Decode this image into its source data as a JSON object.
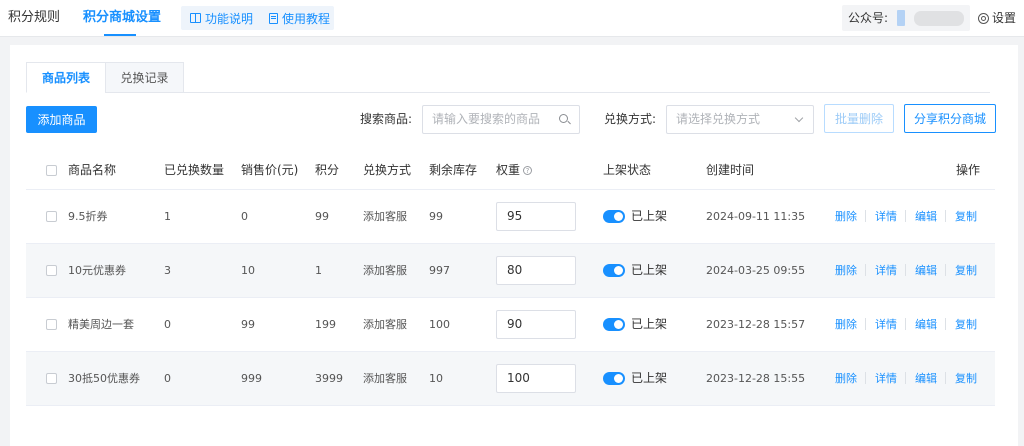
{
  "header": {
    "nav_rules": "积分规则",
    "nav_mall": "积分商城设置",
    "doc_func": "功能说明",
    "doc_tutorial": "使用教程",
    "account_label": "公众号:",
    "settings_label": "设置"
  },
  "tabs": {
    "products": "商品列表",
    "records": "兑换记录"
  },
  "toolbar": {
    "add_label": "添加商品",
    "search_label": "搜索商品:",
    "search_placeholder": "请输入要搜索的商品",
    "exchange_label": "兑换方式:",
    "exchange_placeholder": "请选择兑换方式",
    "bulk_delete_label": "批量删除",
    "share_label": "分享积分商城"
  },
  "table": {
    "headers": {
      "name": "商品名称",
      "exchanged": "已兑换数量",
      "price": "销售价(元)",
      "points": "积分",
      "method": "兑换方式",
      "stock": "剩余库存",
      "weight": "权重",
      "status": "上架状态",
      "created": "创建时间",
      "ops": "操作"
    },
    "rows": [
      {
        "name": "9.5折券",
        "exchanged": "1",
        "price": "0",
        "points": "99",
        "method": "添加客服",
        "stock": "99",
        "weight": "95",
        "status": "已上架",
        "status_on": true,
        "created": "2024-09-11 11:35"
      },
      {
        "name": "10元优惠券",
        "exchanged": "3",
        "price": "10",
        "points": "1",
        "method": "添加客服",
        "stock": "997",
        "weight": "80",
        "status": "已上架",
        "status_on": true,
        "created": "2024-03-25 09:55"
      },
      {
        "name": "精美周边一套",
        "exchanged": "0",
        "price": "99",
        "points": "199",
        "method": "添加客服",
        "stock": "100",
        "weight": "90",
        "status": "已上架",
        "status_on": true,
        "created": "2023-12-28 15:57"
      },
      {
        "name": "30抵50优惠券",
        "exchanged": "0",
        "price": "999",
        "points": "3999",
        "method": "添加客服",
        "stock": "10",
        "weight": "100",
        "status": "已上架",
        "status_on": true,
        "created": "2023-12-28 15:55"
      }
    ],
    "actions": {
      "delete": "删除",
      "detail": "详情",
      "edit": "编辑",
      "copy": "复制"
    }
  },
  "colors": {
    "accent": "#1890ff",
    "row_alt": "#f5f7f9"
  },
  "icons": [
    "book-icon",
    "doc-icon",
    "gear-icon",
    "search-icon",
    "chevron-down-icon",
    "help-icon"
  ]
}
